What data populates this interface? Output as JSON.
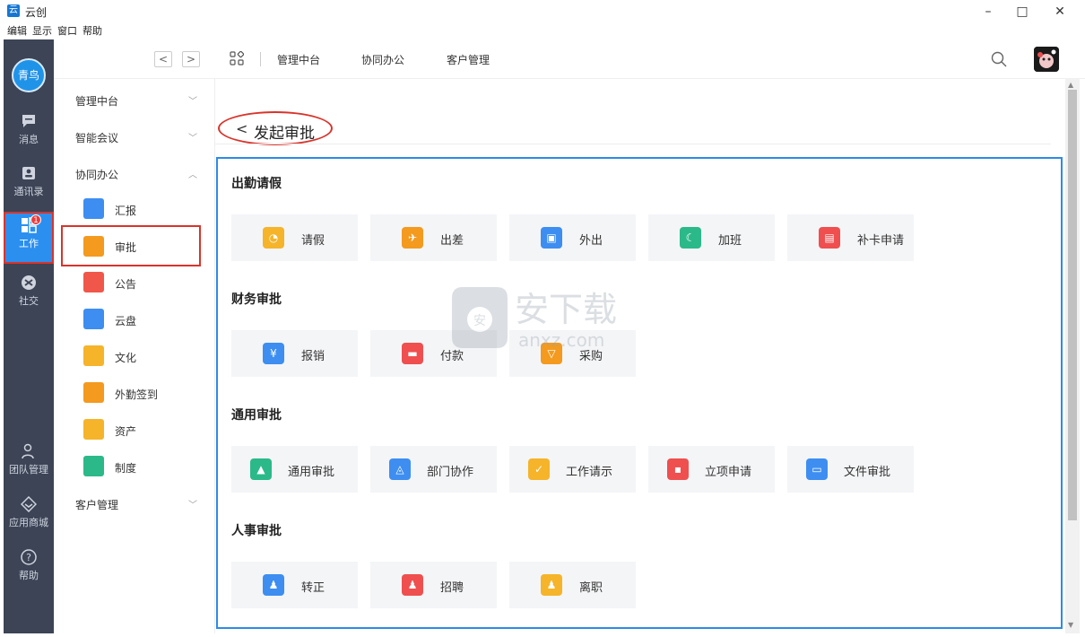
{
  "window": {
    "title": "云创",
    "logo_char": "云",
    "min": "–",
    "max": "□",
    "close": "✕"
  },
  "menu": [
    "编辑",
    "显示",
    "窗口",
    "帮助"
  ],
  "rail": {
    "avatar": "青鸟",
    "items": [
      {
        "label": "消息",
        "icon": "message-icon"
      },
      {
        "label": "通讯录",
        "icon": "contacts-icon"
      },
      {
        "label": "工作",
        "icon": "work-icon",
        "badge": "1"
      },
      {
        "label": "社交",
        "icon": "social-icon"
      },
      {
        "label": "团队管理",
        "icon": "team-icon"
      },
      {
        "label": "应用商城",
        "icon": "store-icon"
      },
      {
        "label": "帮助",
        "icon": "help-icon"
      }
    ]
  },
  "topbar": {
    "back": "<",
    "forward": ">",
    "tabs": [
      "管理中台",
      "协同办公",
      "客户管理"
    ]
  },
  "sidebar": {
    "groups": [
      {
        "label": "管理中台",
        "chevron": "﹀"
      },
      {
        "label": "智能会议",
        "chevron": "﹀"
      },
      {
        "label": "协同办公",
        "chevron": "︿"
      },
      {
        "label": "客户管理",
        "chevron": "﹀"
      }
    ],
    "items": [
      {
        "label": "汇报",
        "color": "#3d8ef0"
      },
      {
        "label": "审批",
        "color": "#f39a1f"
      },
      {
        "label": "公告",
        "color": "#f0574a"
      },
      {
        "label": "云盘",
        "color": "#3d8ef0"
      },
      {
        "label": "文化",
        "color": "#f5b42a"
      },
      {
        "label": "外勤签到",
        "color": "#f39a1f"
      },
      {
        "label": "资产",
        "color": "#f5b42a"
      },
      {
        "label": "制度",
        "color": "#2bb98a"
      }
    ]
  },
  "main": {
    "back_chevron": "<",
    "title": "发起审批",
    "sections": [
      {
        "title": "出勤请假",
        "cards": [
          {
            "label": "请假",
            "color": "#f5b42a",
            "glyph": "◔"
          },
          {
            "label": "出差",
            "color": "#f39a1f",
            "glyph": "✈"
          },
          {
            "label": "外出",
            "color": "#3d8ef0",
            "glyph": "▣"
          },
          {
            "label": "加班",
            "color": "#2bb98a",
            "glyph": "☾"
          },
          {
            "label": "补卡申请",
            "color": "#ef4f4f",
            "glyph": "▤"
          }
        ]
      },
      {
        "title": "财务审批",
        "cards": [
          {
            "label": "报销",
            "color": "#3d8ef0",
            "glyph": "¥"
          },
          {
            "label": "付款",
            "color": "#ef4f4f",
            "glyph": "▬"
          },
          {
            "label": "采购",
            "color": "#f39a1f",
            "glyph": "▽"
          }
        ]
      },
      {
        "title": "通用审批",
        "cards": [
          {
            "label": "通用审批",
            "color": "#2bb98a",
            "glyph": "▲"
          },
          {
            "label": "部门协作",
            "color": "#3d8ef0",
            "glyph": "◬"
          },
          {
            "label": "工作请示",
            "color": "#f5b42a",
            "glyph": "✓"
          },
          {
            "label": "立项申请",
            "color": "#ef4f4f",
            "glyph": "▪"
          },
          {
            "label": "文件审批",
            "color": "#3d8ef0",
            "glyph": "▭"
          }
        ]
      },
      {
        "title": "人事审批",
        "cards": [
          {
            "label": "转正",
            "color": "#3d8ef0",
            "glyph": "♟"
          },
          {
            "label": "招聘",
            "color": "#ef4f4f",
            "glyph": "♟"
          },
          {
            "label": "离职",
            "color": "#f5b42a",
            "glyph": "♟"
          }
        ]
      }
    ]
  },
  "watermark": {
    "text": "安下载",
    "sub": "anxz.com"
  },
  "colors": {
    "accent": "#2d8be6",
    "rail": "#3c4456",
    "highlight": "#d9342b"
  }
}
